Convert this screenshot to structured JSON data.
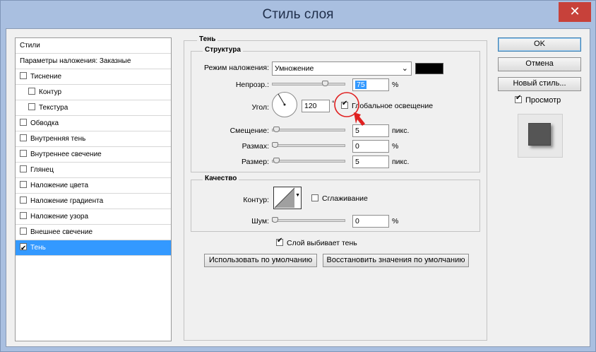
{
  "window": {
    "title": "Стиль слоя",
    "close_symbol": "✕"
  },
  "styles_list": {
    "header": "Стили",
    "blend_options": "Параметры наложения: Заказные",
    "items": [
      {
        "label": "Тиснение",
        "checked": false,
        "sub": false
      },
      {
        "label": "Контур",
        "checked": false,
        "sub": true
      },
      {
        "label": "Текстура",
        "checked": false,
        "sub": true
      },
      {
        "label": "Обводка",
        "checked": false,
        "sub": false
      },
      {
        "label": "Внутренняя тень",
        "checked": false,
        "sub": false
      },
      {
        "label": "Внутреннее свечение",
        "checked": false,
        "sub": false
      },
      {
        "label": "Глянец",
        "checked": false,
        "sub": false
      },
      {
        "label": "Наложение цвета",
        "checked": false,
        "sub": false
      },
      {
        "label": "Наложение градиента",
        "checked": false,
        "sub": false
      },
      {
        "label": "Наложение узора",
        "checked": false,
        "sub": false
      },
      {
        "label": "Внешнее свечение",
        "checked": false,
        "sub": false
      },
      {
        "label": "Тень",
        "checked": true,
        "sub": false,
        "selected": true
      }
    ]
  },
  "shadow": {
    "section_title": "Тень",
    "structure": {
      "title": "Структура",
      "blend_mode_label": "Режим наложения:",
      "blend_mode_value": "Умножение",
      "shadow_color": "#000000",
      "opacity_label": "Непрозр.:",
      "opacity_value": "75",
      "opacity_unit": "%",
      "opacity_fraction": 0.75,
      "angle_label": "Угол:",
      "angle_value": "120",
      "angle_unit": "°",
      "global_light_label": "Глобальное освещение",
      "global_light_checked": true,
      "distance_label": "Смещение:",
      "distance_value": "5",
      "distance_unit": "пикс.",
      "distance_fraction": 0.02,
      "spread_label": "Размах:",
      "spread_value": "0",
      "spread_unit": "%",
      "spread_fraction": 0.0,
      "size_label": "Размер:",
      "size_value": "5",
      "size_unit": "пикс.",
      "size_fraction": 0.02
    },
    "quality": {
      "title": "Качество",
      "contour_label": "Контур:",
      "antialias_label": "Сглаживание",
      "antialias_checked": false,
      "noise_label": "Шум:",
      "noise_value": "0",
      "noise_unit": "%",
      "noise_fraction": 0.0
    },
    "knockout_label": "Слой выбивает тень",
    "knockout_checked": true,
    "make_default": "Использовать по умолчанию",
    "reset_default": "Восстановить значения по умолчанию"
  },
  "side_buttons": {
    "ok": "OK",
    "cancel": "Отмена",
    "new_style": "Новый стиль...",
    "preview_label": "Просмотр",
    "preview_checked": true
  },
  "annotation_color": "#e02020",
  "selection_color": "#3399ff"
}
